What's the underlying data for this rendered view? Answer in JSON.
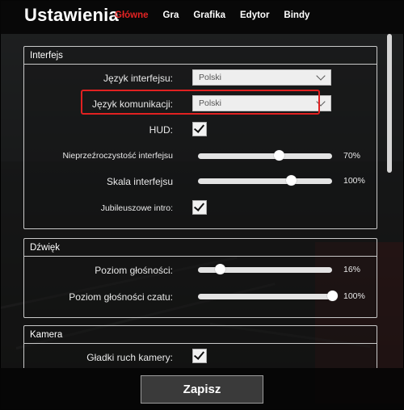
{
  "header": {
    "title": "Ustawienia",
    "tabs": [
      {
        "label": "Główne",
        "active": true
      },
      {
        "label": "Gra",
        "active": false
      },
      {
        "label": "Grafika",
        "active": false
      },
      {
        "label": "Edytor",
        "active": false
      },
      {
        "label": "Bindy",
        "active": false
      }
    ]
  },
  "interface": {
    "title": "Interfejs",
    "language_label": "Język interfejsu:",
    "language_value": "Polski",
    "comm_language_label": "Język komunikacji:",
    "comm_language_value": "Polski",
    "hud_label": "HUD:",
    "hud_checked": true,
    "opacity_label": "Nieprzeźroczystość interfejsu",
    "opacity_value": "70%",
    "opacity_level": 0.6,
    "scale_label": "Skala interfejsu",
    "scale_value": "100%",
    "scale_level": 0.69,
    "intro_label": "Jubileuszowe intro:",
    "intro_checked": true
  },
  "sound": {
    "title": "Dźwięk",
    "volume_label": "Poziom głośności:",
    "volume_value": "16%",
    "volume_level": 0.16,
    "chat_volume_label": "Poziom głośności czatu:",
    "chat_volume_value": "100%",
    "chat_volume_level": 1.0
  },
  "camera": {
    "title": "Kamera",
    "smooth_label": "Gładki ruch kamery:",
    "smooth_checked": true
  },
  "footer": {
    "save_label": "Zapisz"
  },
  "colors": {
    "accent": "#e32323",
    "highlight_border": "#e12121"
  },
  "icons": {
    "dropdown": "chevron-down-icon",
    "check": "checkmark-icon"
  }
}
